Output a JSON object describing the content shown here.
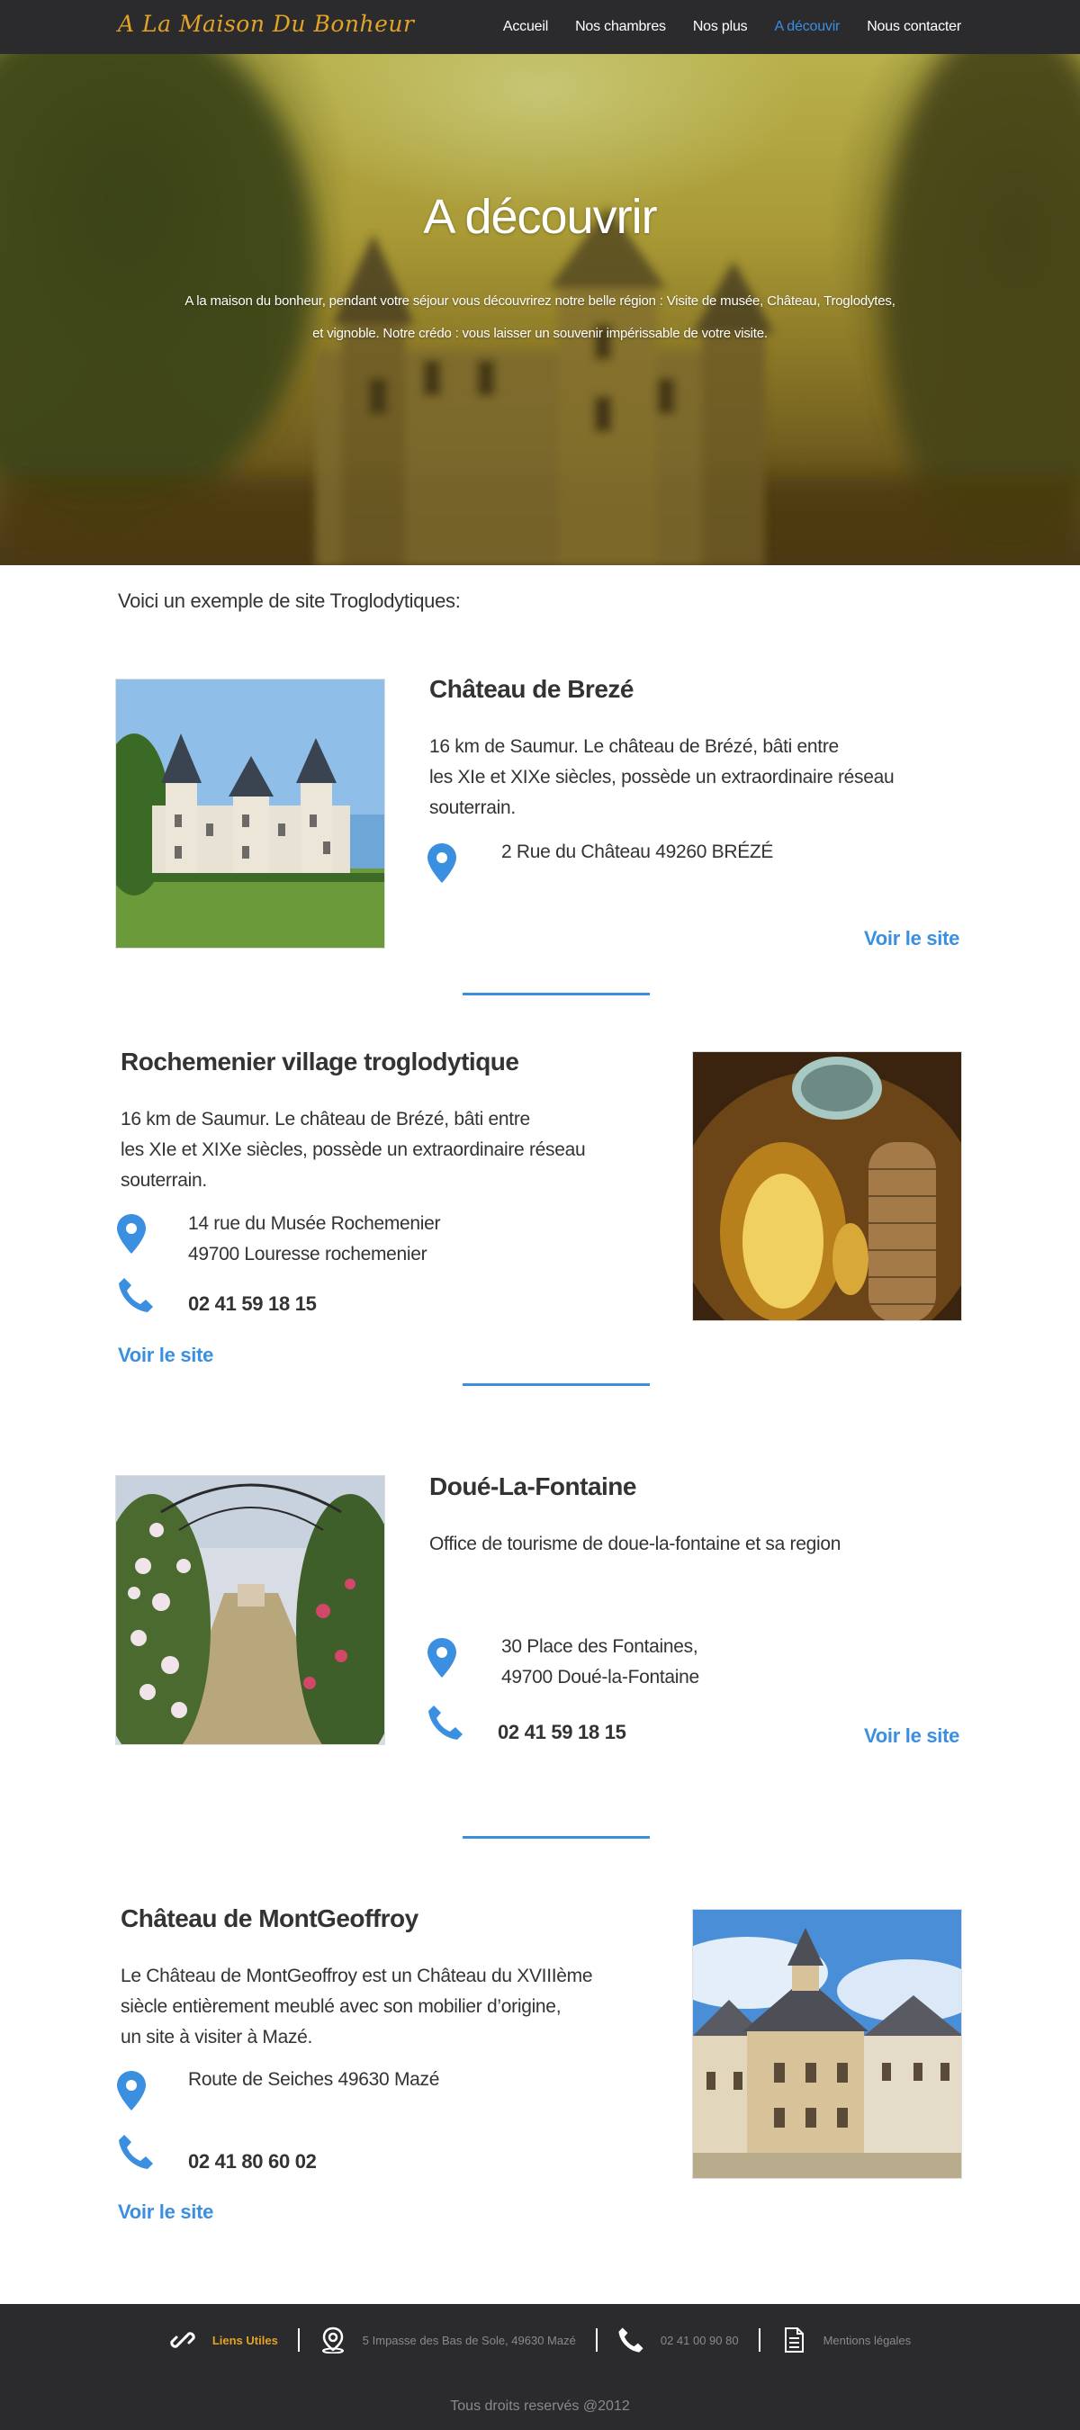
{
  "nav": {
    "logo": "A La Maison Du Bonheur",
    "items": [
      {
        "label": "Accueil"
      },
      {
        "label": "Nos chambres"
      },
      {
        "label": "Nos plus"
      },
      {
        "label": "A découvir",
        "active": true
      },
      {
        "label": "Nous contacter"
      }
    ]
  },
  "hero": {
    "title": "A découvrir",
    "text": "A la maison du bonheur, pendant votre séjour vous découvrirez notre belle région : Visite de musée, Château, Troglodytes, et vignoble. Notre crédo : vous laisser un souvenir impérissable de votre visite."
  },
  "intro": "Voici un exemple de site Troglodytiques:",
  "sections": [
    {
      "title": "Château de Brezé",
      "desc_lines": [
        "16 km de Saumur. Le château de Brézé, bâti entre",
        "les XIe et XIXe siècles, possède un extraordinaire réseau",
        "souterrain."
      ],
      "address_lines": [
        "2 Rue du Château 49260 BRÉZÉ"
      ],
      "link": "Voir le site",
      "icons": [
        "map-pin-icon"
      ]
    },
    {
      "title": "Rochemenier village troglodytique",
      "desc_lines": [
        "16 km de Saumur. Le château de Brézé, bâti entre",
        "les XIe et XIXe siècles, possède un extraordinaire réseau",
        "souterrain."
      ],
      "address_lines": [
        "14 rue du Musée Rochemenier",
        "49700 Louresse rochemenier"
      ],
      "phone": "02 41 59 18 15",
      "link": "Voir le site",
      "icons": [
        "map-pin-icon",
        "phone-icon"
      ]
    },
    {
      "title": "Doué-La-Fontaine",
      "desc_lines": [
        "Office de tourisme de doue-la-fontaine et sa region"
      ],
      "address_lines": [
        "30 Place des Fontaines,",
        "49700 Doué-la-Fontaine"
      ],
      "phone": "02 41 59 18 15",
      "link": "Voir le site",
      "icons": [
        "map-pin-icon",
        "phone-icon"
      ]
    },
    {
      "title": "Château de MontGeoffroy",
      "desc_lines": [
        "Le Château de MontGeoffroy est un Château du XVIIIème",
        " siècle entièrement meublé avec son mobilier d’origine,",
        " un site à visiter à Mazé."
      ],
      "address_lines": [
        "Route de Seiches  49630 Mazé"
      ],
      "phone": "02 41 80 60 02",
      "link": "Voir le site",
      "icons": [
        "map-pin-icon",
        "phone-icon"
      ]
    }
  ],
  "footer": {
    "links_label": "Liens Utiles",
    "address": "5 Impasse des Bas de Sole, 49630 Mazé",
    "phone": "02 41 00 90 80",
    "legal": "Mentions légales",
    "copyright": "Tous droits reservés @2012"
  },
  "colors": {
    "accent": "#3b8fe0",
    "logo": "#e2a327",
    "nav_bg": "#2b2b2d"
  }
}
